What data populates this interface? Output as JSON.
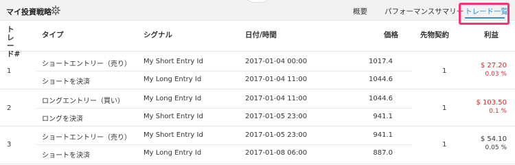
{
  "header": {
    "title": "マイ投資戦略",
    "tabs": [
      "概要",
      "パフォーマンスサマリー",
      "トレード一覧"
    ]
  },
  "colors": {
    "accent": "#2d8fd5",
    "highlight": "#ff2f74",
    "loss": "#d12a2a"
  },
  "table": {
    "columns": [
      "トレード#",
      "タイプ",
      "シグナル",
      "日付/時間",
      "価格",
      "先物契約",
      "利益"
    ],
    "trades": [
      {
        "num": "1",
        "entry_type": "ショートエントリー（売り）",
        "entry_signal": "My Short Entry Id",
        "entry_date": "2017-01-04 00:00",
        "entry_price": "1017.4",
        "exit_type": "ショートを決済",
        "exit_signal": "My Long Entry Id",
        "exit_date": "2017-01-04 11:00",
        "exit_price": "1044.6",
        "contracts": "1",
        "profit": "$ 27.20",
        "profit_pct": "0.03 %",
        "profit_kind": "loss"
      },
      {
        "num": "2",
        "entry_type": "ロングエントリー（買い）",
        "entry_signal": "My Long Entry Id",
        "entry_date": "2017-01-04 11:00",
        "entry_price": "1044.6",
        "exit_type": "ロングを決済",
        "exit_signal": "My Short Entry Id",
        "exit_date": "2017-01-05 23:00",
        "exit_price": "941.1",
        "contracts": "1",
        "profit": "$ 103.50",
        "profit_pct": "0.1 %",
        "profit_kind": "loss"
      },
      {
        "num": "3",
        "entry_type": "ショートエントリー（売り）",
        "entry_signal": "My Short Entry Id",
        "entry_date": "2017-01-05 23:00",
        "entry_price": "941.1",
        "exit_type": "ショートを決済",
        "exit_signal": "My Long Entry Id",
        "exit_date": "2017-01-08 06:00",
        "exit_price": "887.0",
        "contracts": "1",
        "profit": "$ 54.10",
        "profit_pct": "0.05 %",
        "profit_kind": "gain"
      }
    ]
  }
}
